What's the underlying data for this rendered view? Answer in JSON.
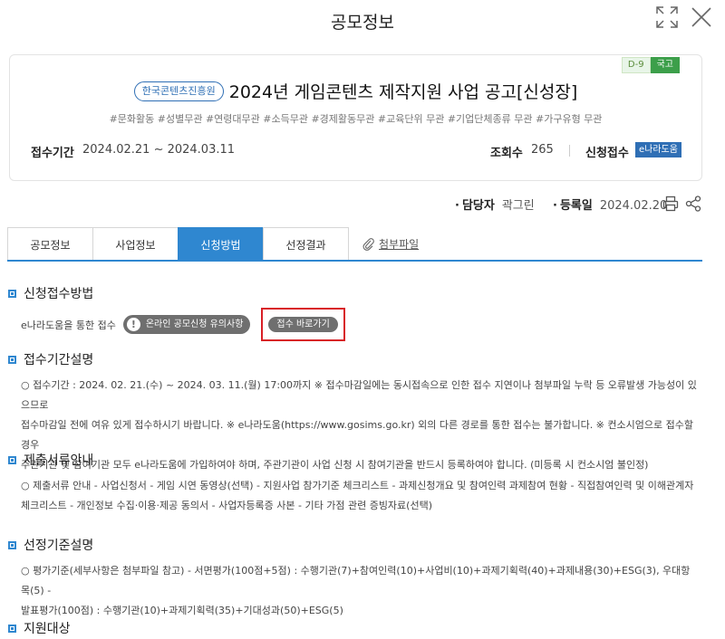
{
  "modal": {
    "title": "공모정보"
  },
  "card": {
    "dday": "D-9",
    "gov": "국고",
    "agency": "한국콘텐츠진흥원",
    "title": "2024년 게임콘텐츠 제작지원 사업 공고[신성장]",
    "tags": "#문화활동 #성별무관 #연령대무관 #소득무관 #경제활동무관 #교육단위 무관 #기업단체종류 무관 #가구유형 무관",
    "period_label": "접수기간",
    "period_value": "2024.02.21 ~ 2024.03.11",
    "views_label": "조회수",
    "views_value": "265",
    "apply_label": "신청접수",
    "apply_badge": "e나라도움"
  },
  "meta": {
    "manager_label": "담당자",
    "manager_value": "곽그린",
    "reg_label": "등록일",
    "reg_value": "2024.02.20"
  },
  "tabs": [
    {
      "label": "공모정보"
    },
    {
      "label": "사업정보"
    },
    {
      "label": "신청방법"
    },
    {
      "label": "선정결과"
    }
  ],
  "attachment_label": "첨부파일",
  "sections": {
    "method": {
      "title": "신청접수방법",
      "text": "e나라도움을 통한 접수",
      "notice_button": "온라인 공모신청 유의사항",
      "go_button": "접수 바로가기"
    },
    "period": {
      "title": "접수기간설명",
      "lines": [
        "○ 접수기간 : 2024. 02. 21.(수) ~ 2024. 03. 11.(월) 17:00까지 ※ 접수마감일에는 동시접속으로 인한 접수 지연이나 첨부파일 누락 등 오류발생 가능성이 있으므로",
        "접수마감일 전에 여유 있게 접수하시기 바랍니다. ※ e나라도움(https://www.gosims.go.kr) 외의 다른 경로를 통한 접수는 불가합니다. ※ 컨소시엄으로 접수할 경우",
        "주관기관 및 참여기관 모두 e나라도움에 가입하여야 하며, 주관기관이 사업 신청 시 참여기관을 반드시 등록하여야 합니다. (미등록 시 컨소시엄 불인정)"
      ]
    },
    "docs": {
      "title": "제출서류안내",
      "lines": [
        "○ 제출서류 안내 - 사업신청서 - 게임 시연 동영상(선택) - 지원사업 참가기준 체크리스트 - 과제신청개요 및 참여인력 과제참여 현황 - 직접참여인력 및 이해관계자",
        "체크리스트 - 개인정보 수집·이용·제공 동의서 - 사업자등록증 사본 - 기타 가점 관련 증빙자료(선택)"
      ]
    },
    "criteria": {
      "title": "선정기준설명",
      "lines": [
        "○ 평가기준(세부사항은 첨부파일 참고) - 서면평가(100점+5점) : 수행기관(7)+참여인력(10)+사업비(10)+과제기획력(40)+과제내용(30)+ESG(3), 우대항목(5) -",
        "발표평가(100점) : 수행기관(10)+과제기획력(35)+기대성과(50)+ESG(5)"
      ]
    },
    "target": {
      "title": "지원대상"
    }
  },
  "colors": {
    "accent": "#2f87d0",
    "highlight": "#d81f26",
    "gov_badge": "#3c9f4a"
  },
  "icons": [
    "expand-icon",
    "close-icon",
    "print-icon",
    "share-icon",
    "paperclip-icon",
    "exclamation-icon"
  ]
}
